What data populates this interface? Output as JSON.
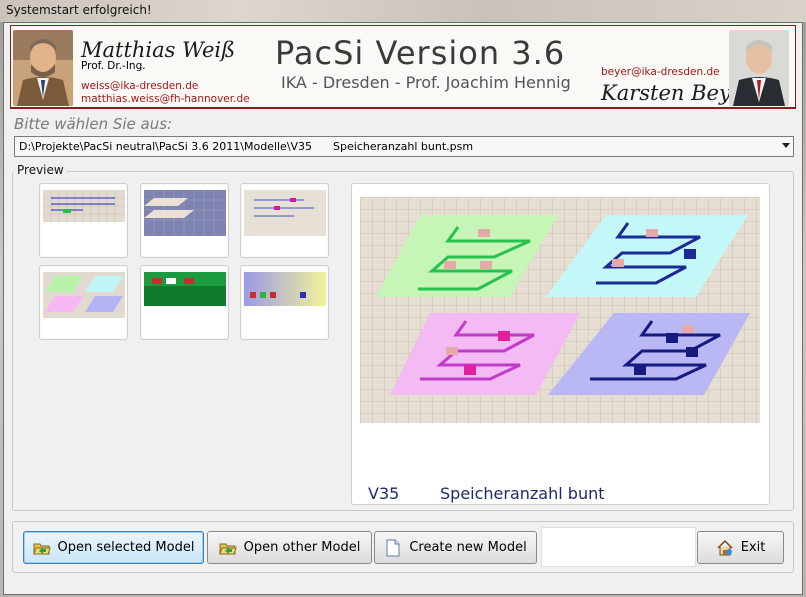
{
  "window": {
    "title": "Systemstart erfolgreich!"
  },
  "banner": {
    "left_name": "Matthias Weiß",
    "left_title": "Prof. Dr.-Ing.",
    "left_email1": "weiss@ika-dresden.de",
    "left_email2": "matthias.weiss@fh-hannover.de",
    "app_name": "PacSi Version 3.6",
    "app_sub": "IKA - Dresden - Prof. Joachim Hennig",
    "right_email": "beyer@ika-dresden.de",
    "right_name": "Karsten Beyer"
  },
  "prompt": "Bitte wählen Sie aus:",
  "file_select": {
    "value": "D:\\Projekte\\PacSi neutral\\PacSi 3.6 2011\\Modelle\\V35      Speicheranzahl bunt.psm"
  },
  "preview": {
    "label": "Preview",
    "selected_number": "V35",
    "selected_name": "Speicheranzahl bunt"
  },
  "buttons": {
    "open_selected": "Open selected Model",
    "open_other": "Open other Model",
    "create_new": "Create new Model",
    "exit": "Exit"
  },
  "icons": {
    "open_selected": "folder-open-icon",
    "open_other": "folder-open-icon",
    "create_new": "document-new-icon",
    "exit": "house-exit-icon"
  },
  "colors": {
    "accent_text": "#1f2a6e",
    "banner_border": "#8b1c1c",
    "focus_border": "#3c7fb1"
  }
}
